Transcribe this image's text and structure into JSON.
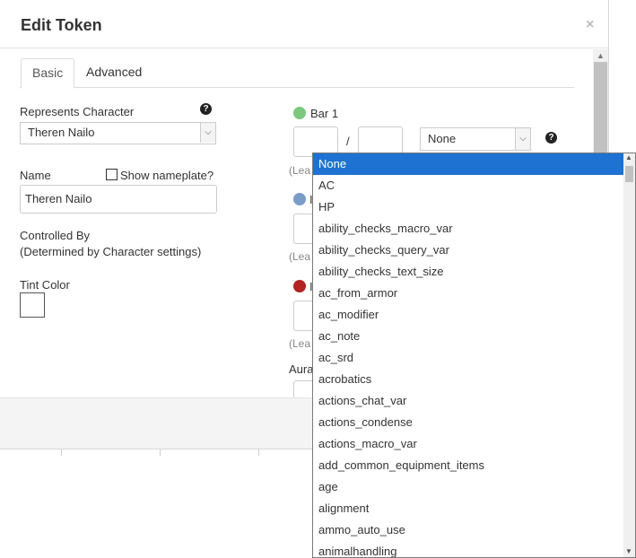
{
  "dialog": {
    "title": "Edit Token",
    "close": "×"
  },
  "tabs": [
    {
      "label": "Basic"
    },
    {
      "label": "Advanced"
    }
  ],
  "basic": {
    "represents_label": "Represents Character",
    "represents_value": "Theren Nailo",
    "name_label": "Name",
    "show_nameplate_label": "Show nameplate?",
    "name_value": "Theren Nailo",
    "controlled_label": "Controlled By",
    "controlled_note": "(Determined by Character settings)",
    "tint_label": "Tint Color",
    "help": "?"
  },
  "bar1": {
    "label": "Bar 1",
    "color": "#7ec87e",
    "slash": "/",
    "link_value": "None",
    "note_fragment": "(Lea"
  },
  "bar2": {
    "label": "I",
    "color": "#7a9cc8",
    "note_fragment": "(Lea"
  },
  "bar3": {
    "label": "I",
    "color": "#b22222",
    "note_fragment": "(Lea"
  },
  "aura_fragment": "Aura",
  "dropdown": {
    "items": [
      "None",
      "AC",
      "HP",
      "ability_checks_macro_var",
      "ability_checks_query_var",
      "ability_checks_text_size",
      "ac_from_armor",
      "ac_modifier",
      "ac_note",
      "ac_srd",
      "acrobatics",
      "actions_chat_var",
      "actions_condense",
      "actions_macro_var",
      "add_common_equipment_items",
      "age",
      "alignment",
      "ammo_auto_use",
      "animalhandling"
    ],
    "selected": "None",
    "selected_color": "#1e73d2"
  }
}
